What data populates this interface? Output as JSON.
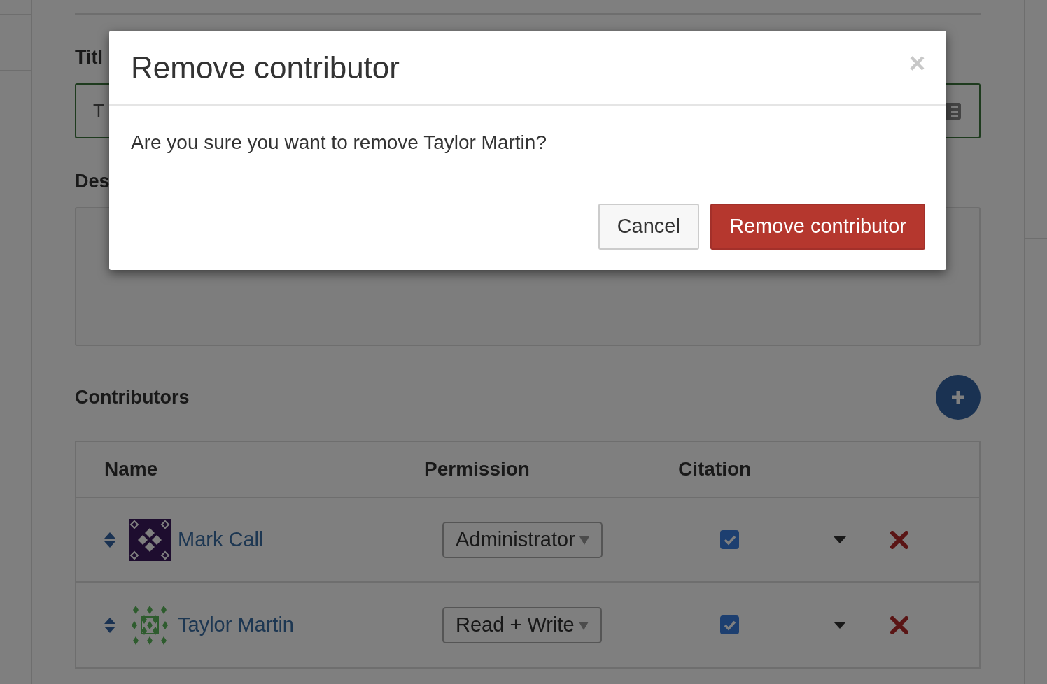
{
  "page": {
    "title_label": "Titl",
    "title_value": "T",
    "description_label": "Des",
    "contributors_heading": "Contributors",
    "table": {
      "columns": [
        "Name",
        "Permission",
        "Citation"
      ],
      "rows": [
        {
          "name": "Mark Call",
          "permission": "Administrator",
          "checked": true
        },
        {
          "name": "Taylor Martin",
          "permission": "Read + Write",
          "checked": true
        }
      ]
    }
  },
  "dialog": {
    "title": "Remove contributor",
    "close": "×",
    "message": "Are you sure you want to remove Taylor Martin?",
    "buttons": [
      {
        "label": "Cancel",
        "kind": "secondary"
      },
      {
        "label": "Remove contributor",
        "kind": "danger"
      }
    ]
  }
}
